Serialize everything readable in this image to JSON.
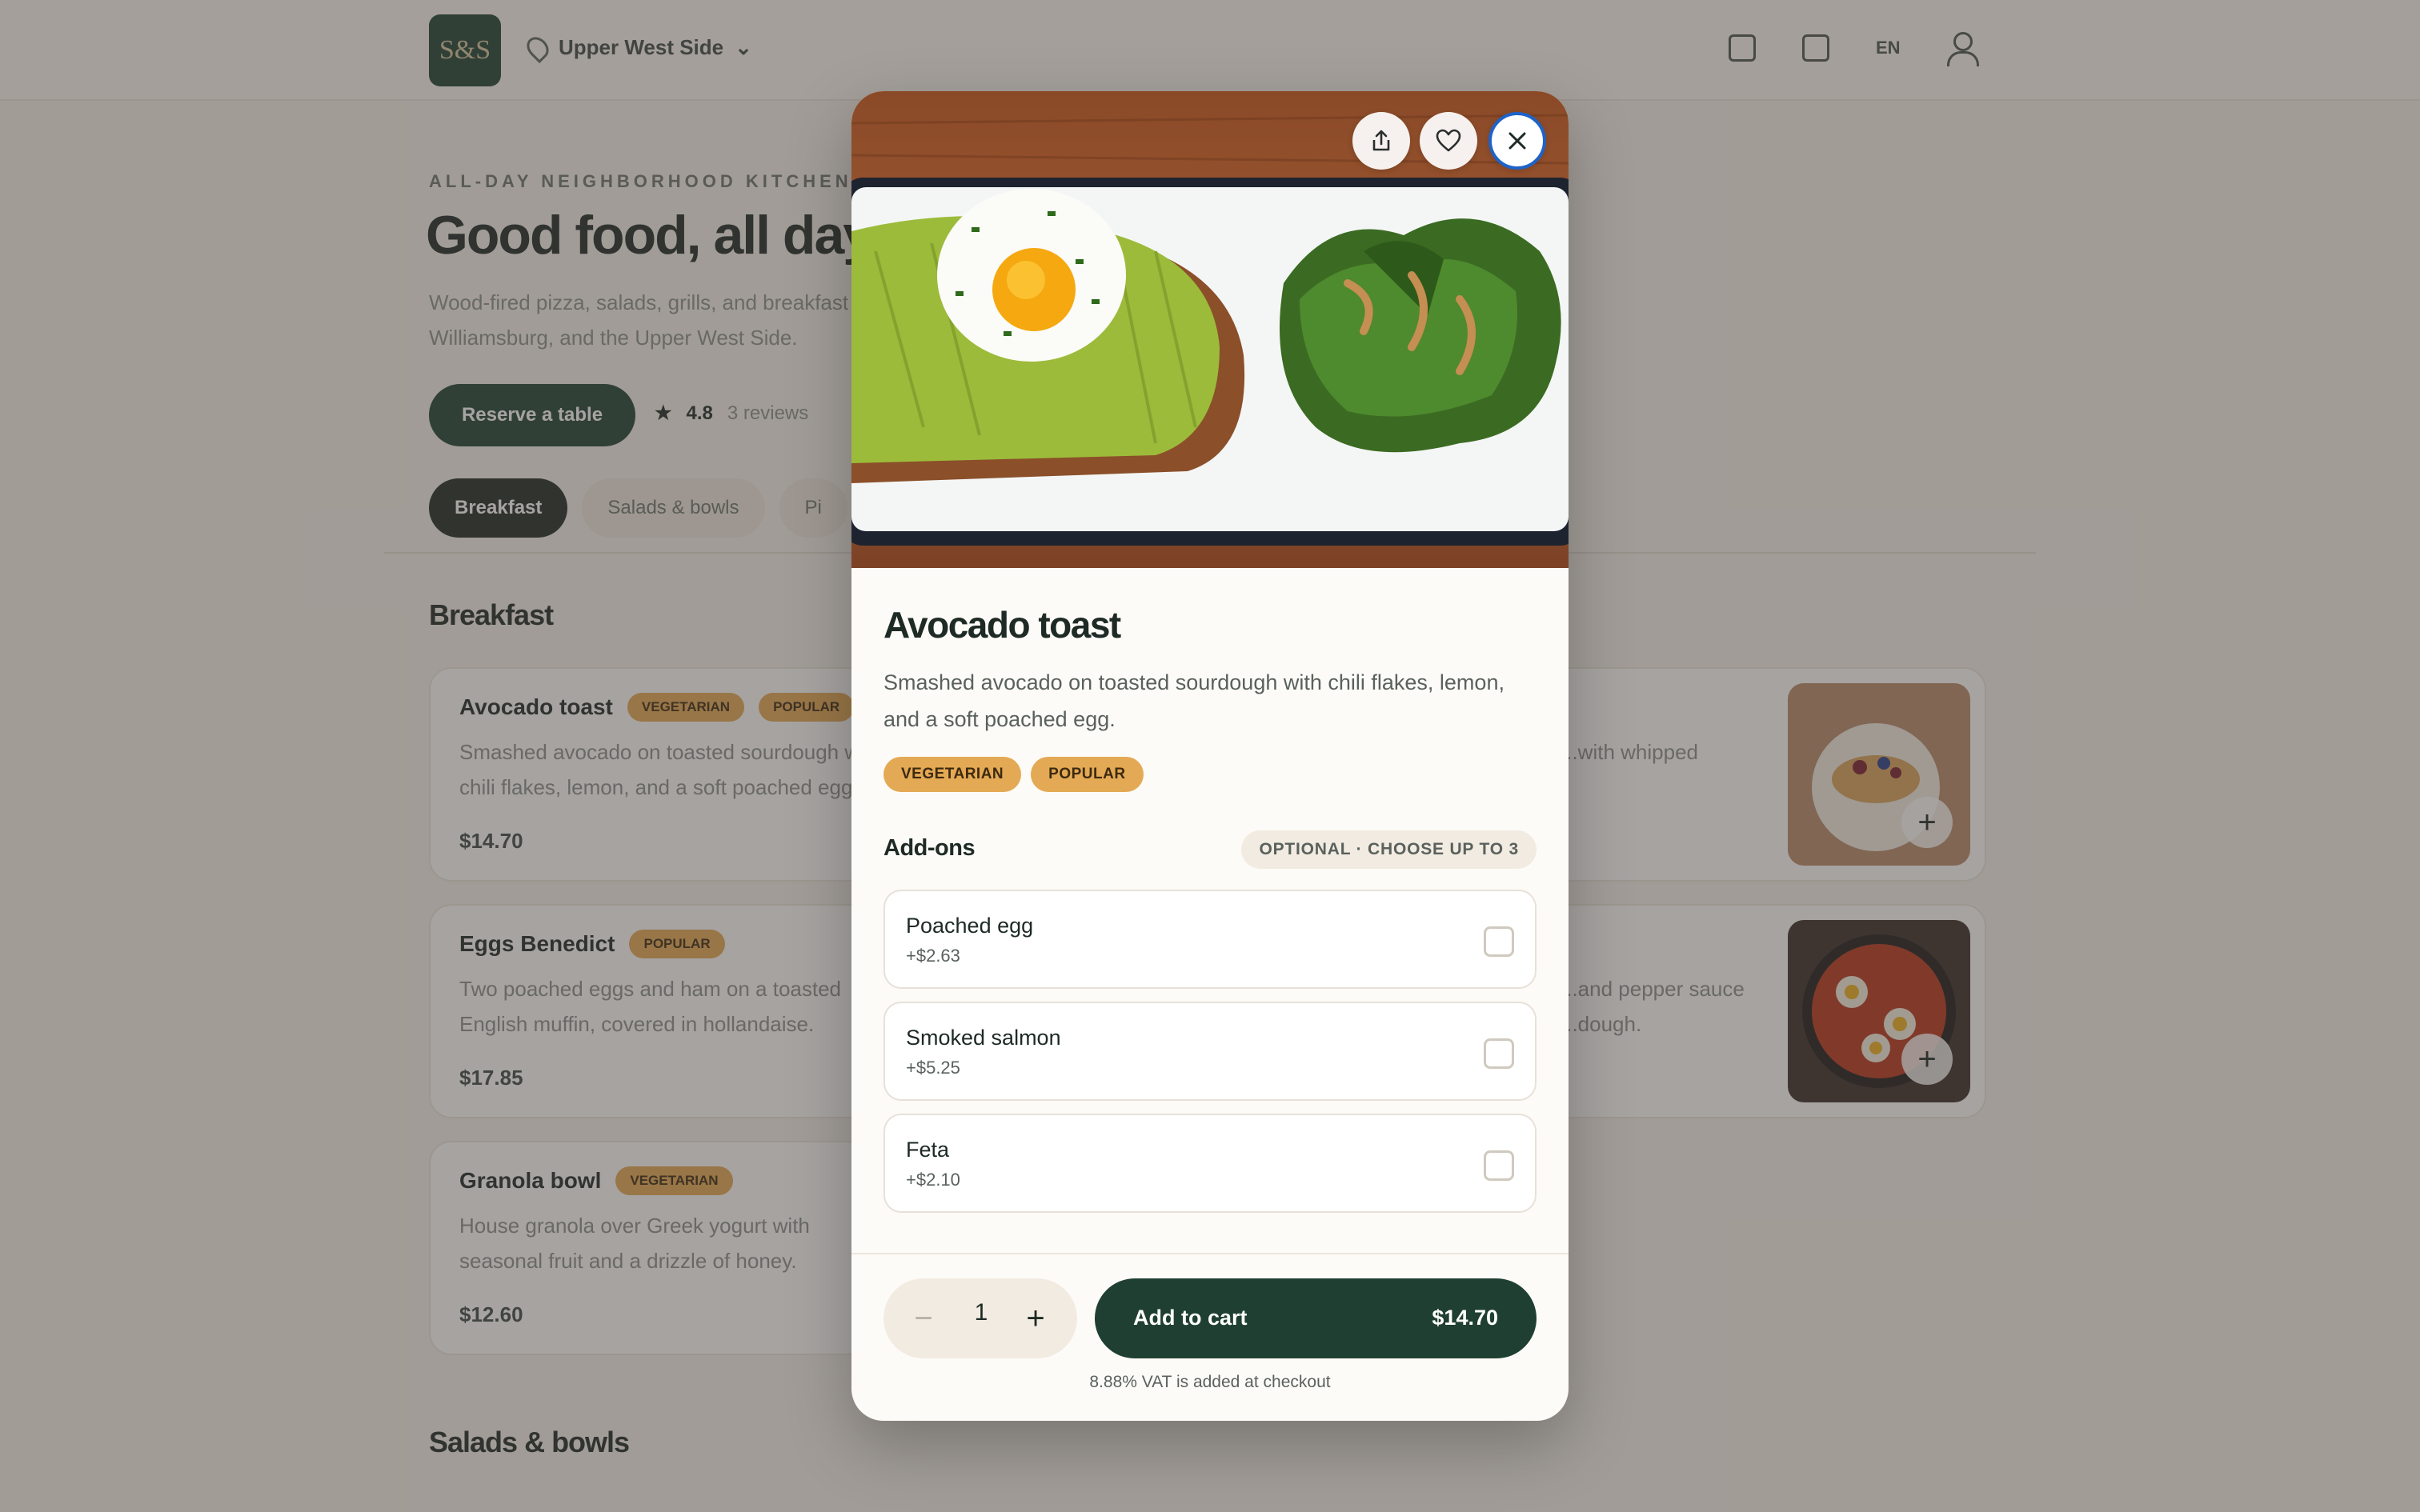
{
  "header": {
    "logo_text": "S&S",
    "location": "Upper West Side",
    "lang": "EN",
    "icons": [
      "bag-icon",
      "calendar-icon",
      "user-icon"
    ]
  },
  "hero": {
    "eyebrow": "ALL-DAY NEIGHBORHOOD KITCHEN",
    "title": "Good food, all day",
    "subtitle": "Wood-fired pizza, salads, grills, and breakfast in Williamsburg, and the Upper West Side.",
    "reserve_label": "Reserve a table",
    "rating": "4.8",
    "reviews": "3 reviews"
  },
  "category_tabs": [
    "Breakfast",
    "Salads & bowls",
    "Pi"
  ],
  "sections": {
    "breakfast": "Breakfast",
    "salads": "Salads & bowls"
  },
  "menu_cards": [
    {
      "name": "Avocado toast",
      "badges": [
        "VEGETARIAN",
        "POPULAR"
      ],
      "desc": "Smashed avocado on toasted sourdough with chili flakes, lemon, and a soft poached egg.",
      "price": "$14.70"
    },
    {
      "name": "Eggs Benedict",
      "badges": [
        "POPULAR"
      ],
      "desc": "Two poached eggs and ham on a toasted English muffin, covered in hollandaise.",
      "price": "$17.85"
    },
    {
      "name": "Granola bowl",
      "badges": [
        "VEGETARIAN"
      ],
      "desc": "House granola over Greek yogurt with seasonal fruit and a drizzle of honey.",
      "price": "$12.60"
    },
    {
      "name": "",
      "badges": [
        ""
      ],
      "desc": "...with whipped",
      "price": ""
    },
    {
      "name": "",
      "badges": [
        ""
      ],
      "desc": "...and pepper sauce ...dough.",
      "price": ""
    }
  ],
  "modal": {
    "title": "Avocado toast",
    "description": "Smashed avocado on toasted sourdough with chili flakes, lemon, and a soft poached egg.",
    "tags": [
      "VEGETARIAN",
      "POPULAR"
    ],
    "addons_title": "Add-ons",
    "addons_hint": "OPTIONAL · CHOOSE UP TO 3",
    "addons": [
      {
        "name": "Poached egg",
        "price": "+$2.63",
        "checked": false
      },
      {
        "name": "Smoked salmon",
        "price": "+$5.25",
        "checked": false
      },
      {
        "name": "Feta",
        "price": "+$2.10",
        "checked": false
      }
    ],
    "quantity": "1",
    "minus_symbol": "−",
    "plus_symbol": "+",
    "add_to_cart_label": "Add to cart",
    "total": "$14.70",
    "vat_note": "8.88% VAT is added at checkout",
    "buttons": [
      "share-icon",
      "heart-icon",
      "close-icon"
    ]
  },
  "colors": {
    "brand_green": "#1f3f32",
    "tag_amber": "#e4a954",
    "close_ring": "#1d63c9"
  }
}
